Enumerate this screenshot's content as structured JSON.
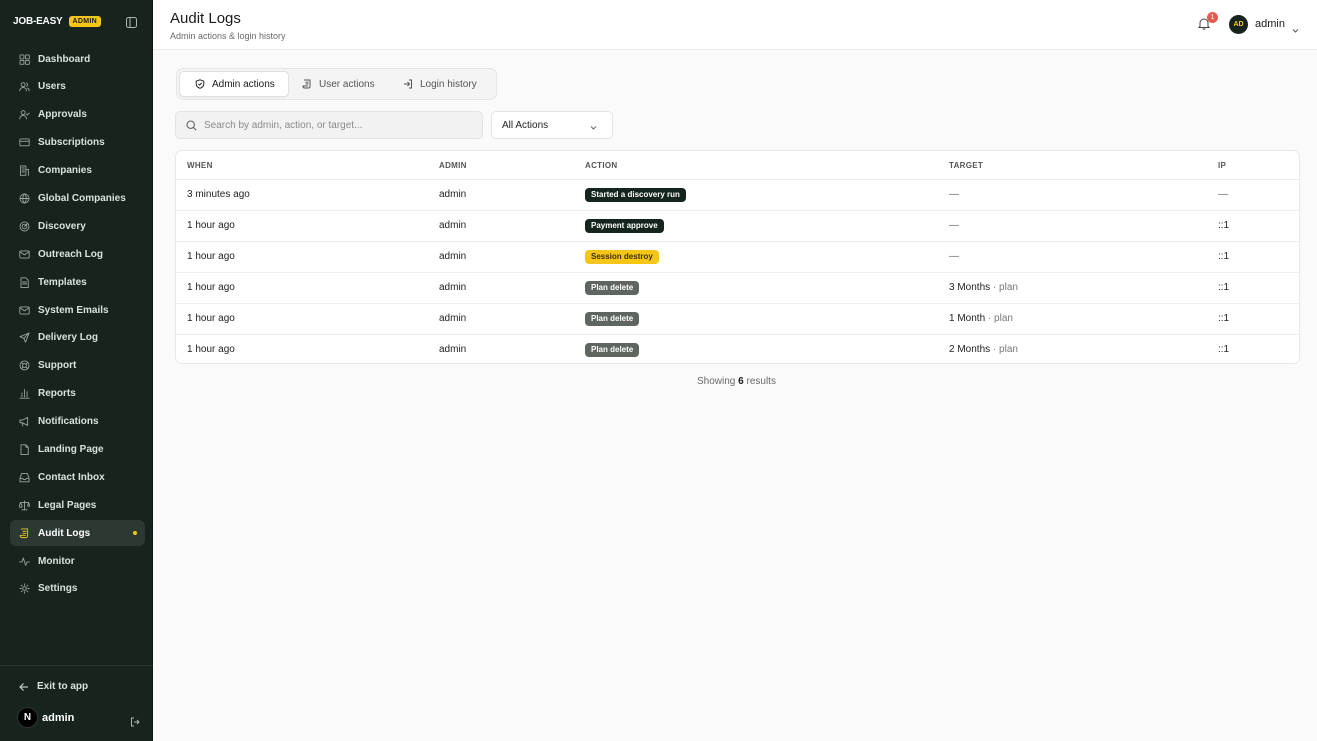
{
  "brand": {
    "name": "JOB-EASY",
    "badge": "ADMIN"
  },
  "sidebar": {
    "items": [
      {
        "label": "Dashboard",
        "icon": "dashboard-icon"
      },
      {
        "label": "Users",
        "icon": "users-icon"
      },
      {
        "label": "Approvals",
        "icon": "user-check-icon"
      },
      {
        "label": "Subscriptions",
        "icon": "credit-card-icon"
      },
      {
        "label": "Companies",
        "icon": "building-icon"
      },
      {
        "label": "Global Companies",
        "icon": "globe-icon"
      },
      {
        "label": "Discovery",
        "icon": "radar-icon"
      },
      {
        "label": "Outreach Log",
        "icon": "mail-icon"
      },
      {
        "label": "Templates",
        "icon": "file-text-icon"
      },
      {
        "label": "System Emails",
        "icon": "mail-icon"
      },
      {
        "label": "Delivery Log",
        "icon": "send-icon"
      },
      {
        "label": "Support",
        "icon": "lifebuoy-icon"
      },
      {
        "label": "Reports",
        "icon": "bar-chart-icon"
      },
      {
        "label": "Notifications",
        "icon": "megaphone-icon"
      },
      {
        "label": "Landing Page",
        "icon": "file-icon"
      },
      {
        "label": "Contact Inbox",
        "icon": "inbox-icon"
      },
      {
        "label": "Legal Pages",
        "icon": "scale-icon"
      },
      {
        "label": "Audit Logs",
        "icon": "scroll-icon",
        "active": true
      },
      {
        "label": "Monitor",
        "icon": "activity-icon"
      },
      {
        "label": "Settings",
        "icon": "gear-icon"
      }
    ],
    "exit_label": "Exit to app",
    "user": {
      "avatar_letter": "N",
      "name": "admin"
    }
  },
  "header": {
    "title": "Audit Logs",
    "subtitle": "Admin actions & login history",
    "notification_count": "1",
    "avatar_initials": "AD",
    "username": "admin"
  },
  "tabs": [
    {
      "label": "Admin actions",
      "icon": "shield-icon",
      "active": true
    },
    {
      "label": "User actions",
      "icon": "scroll-icon",
      "active": false
    },
    {
      "label": "Login history",
      "icon": "login-icon",
      "active": false
    }
  ],
  "filters": {
    "search_placeholder": "Search by admin, action, or target...",
    "search_value": "",
    "action_select": "All Actions"
  },
  "table": {
    "columns": [
      "WHEN",
      "ADMIN",
      "ACTION",
      "TARGET",
      "IP"
    ],
    "rows": [
      {
        "when": "3 minutes ago",
        "admin": "admin",
        "action": "Started a discovery run",
        "action_style": "dark",
        "target": "—",
        "target_type": "",
        "ip": "—"
      },
      {
        "when": "1 hour ago",
        "admin": "admin",
        "action": "Payment approve",
        "action_style": "dark",
        "target": "—",
        "target_type": "",
        "ip": "::1"
      },
      {
        "when": "1 hour ago",
        "admin": "admin",
        "action": "Session destroy",
        "action_style": "yellow",
        "target": "—",
        "target_type": "",
        "ip": "::1"
      },
      {
        "when": "1 hour ago",
        "admin": "admin",
        "action": "Plan delete",
        "action_style": "gray",
        "target": "3 Months",
        "target_type": "· plan",
        "ip": "::1"
      },
      {
        "when": "1 hour ago",
        "admin": "admin",
        "action": "Plan delete",
        "action_style": "gray",
        "target": "1 Month",
        "target_type": "· plan",
        "ip": "::1"
      },
      {
        "when": "1 hour ago",
        "admin": "admin",
        "action": "Plan delete",
        "action_style": "gray",
        "target": "2 Months",
        "target_type": "· plan",
        "ip": "::1"
      }
    ]
  },
  "results": {
    "prefix": "Showing",
    "count": "6",
    "suffix": "results"
  },
  "colors": {
    "sidebar_bg": "#17241e",
    "accent_yellow": "#f5c518",
    "badge_dark": "#14251d",
    "badge_gray": "#5f6660",
    "notification_red": "#e65b4f"
  }
}
